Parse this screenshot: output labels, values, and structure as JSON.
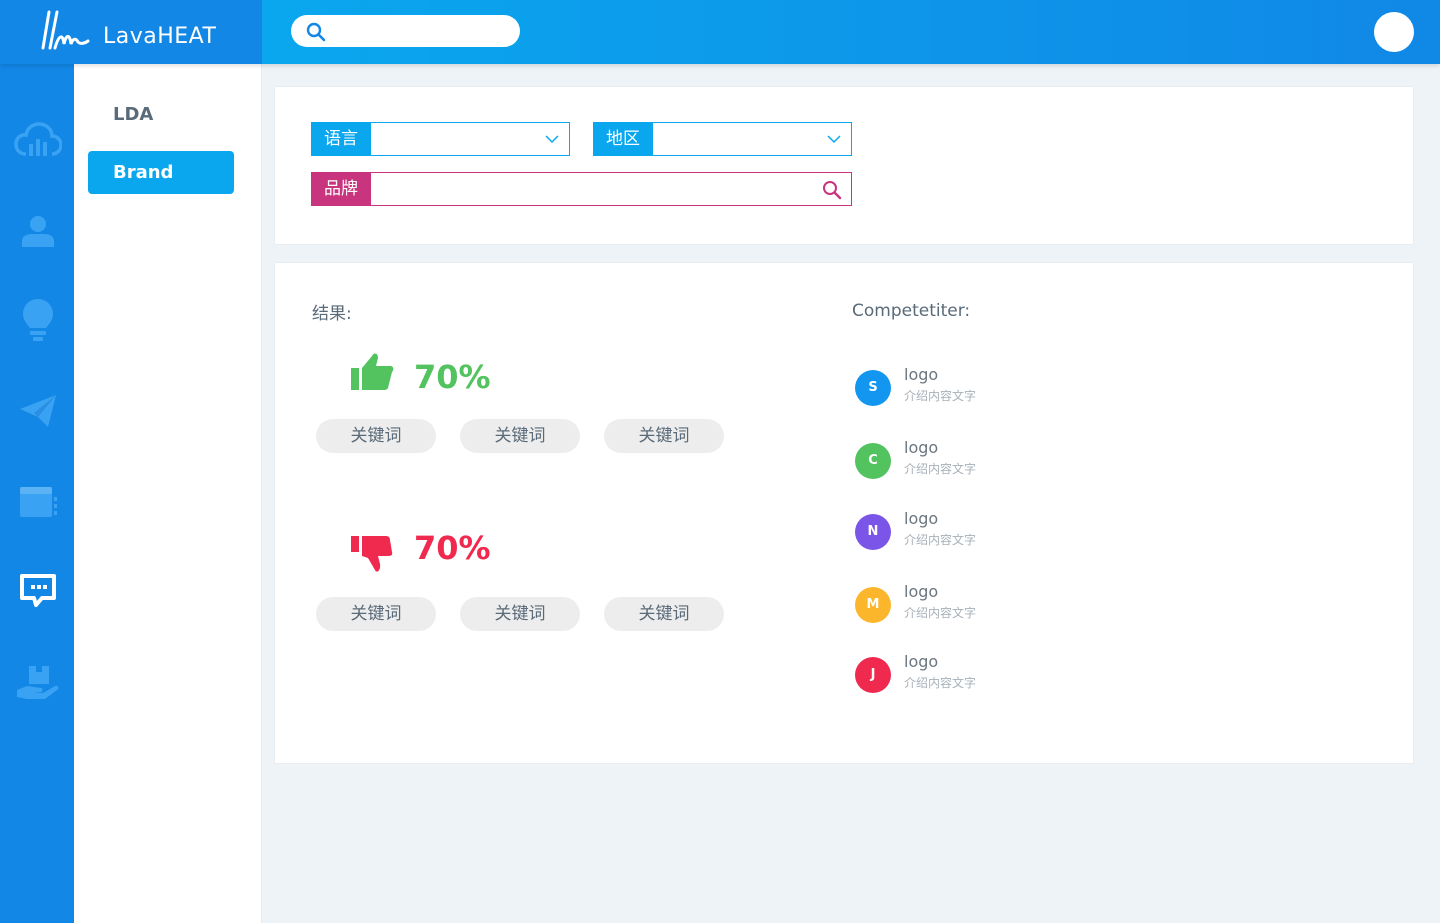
{
  "app": {
    "name": "LavaHEAT"
  },
  "header": {
    "search_placeholder": ""
  },
  "rail": {
    "items": [
      {
        "icon": "cloud-analytics-icon"
      },
      {
        "icon": "user-icon"
      },
      {
        "icon": "lightbulb-icon"
      },
      {
        "icon": "paper-plane-icon"
      },
      {
        "icon": "window-icon"
      },
      {
        "icon": "chat-icon",
        "active": true
      },
      {
        "icon": "box-hand-icon"
      }
    ]
  },
  "subnav": {
    "items": [
      {
        "label": "LDA"
      },
      {
        "label": "Brand",
        "active": true
      }
    ]
  },
  "filters": {
    "language": {
      "label": "语言",
      "value": ""
    },
    "region": {
      "label": "地区",
      "value": ""
    },
    "brand": {
      "label": "品牌",
      "value": ""
    }
  },
  "results": {
    "title": "结果:",
    "positive": {
      "percent": "70%",
      "keywords": [
        "关键词",
        "关键词",
        "关键词"
      ]
    },
    "negative": {
      "percent": "70%",
      "keywords": [
        "关键词",
        "关键词",
        "关键词"
      ]
    }
  },
  "competitors": {
    "title": "Competetiter:",
    "items": [
      {
        "initial": "S",
        "color": "#1296f0",
        "name": "logo",
        "desc": "介绍内容文字"
      },
      {
        "initial": "C",
        "color": "#52c35f",
        "name": "logo",
        "desc": "介绍内容文字"
      },
      {
        "initial": "N",
        "color": "#7a55e8",
        "name": "logo",
        "desc": "介绍内容文字"
      },
      {
        "initial": "M",
        "color": "#fbb62b",
        "name": "logo",
        "desc": "介绍内容文字"
      },
      {
        "initial": "J",
        "color": "#f0294f",
        "name": "logo",
        "desc": "介绍内容文字"
      }
    ]
  },
  "colors": {
    "primary": "#1287e6",
    "accent": "#0aa7ee",
    "brand_pink": "#c8347d",
    "positive": "#52c35f",
    "negative": "#f0294f"
  }
}
